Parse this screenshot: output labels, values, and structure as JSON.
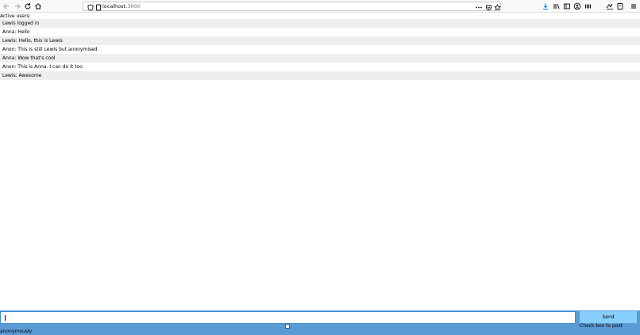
{
  "browser": {
    "url_host": "localhost",
    "url_port": ":3000",
    "icons": [
      "back-icon",
      "forward-icon",
      "reload-icon",
      "home-icon",
      "shield-icon",
      "page-icon",
      "more-icon",
      "pocket-icon",
      "bookmark-star-icon",
      "download-icon",
      "library-icon",
      "sidebar-icon",
      "account-icon",
      "extensions-icon",
      "screenshot-icon",
      "reader-icon",
      "menu-icon"
    ]
  },
  "page": {
    "active_users_label": "Active users:",
    "messages": [
      "Lewis logged in",
      "Anna: Hello",
      "Lewis: Hello, this is Lewis",
      "Anon: This is still Lewis but anonymised",
      "Anna: Wow that's cool",
      "Anon: This is Anna. I can do it too",
      "Lewis: Awesome"
    ]
  },
  "form": {
    "input_value": "",
    "send_label": "Send",
    "hint": "Check box to post",
    "anon_label": "anonymously",
    "bar_color": "#5b9bd5",
    "button_color": "#87cefa"
  }
}
